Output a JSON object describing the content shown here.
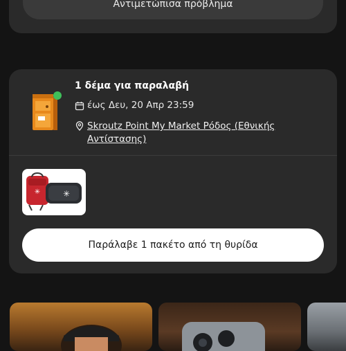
{
  "top_card": {
    "report_button_label": "Αντιμετώπισα πρόβλημα"
  },
  "pickup": {
    "title": "1 δέμα για παραλαβή",
    "deadline": "έως Δευ, 20 Απρ 23:59",
    "location": "Skroutz Point My Market Ρόδος (Εθνικής Αντίστασης)",
    "status_color": "#3fbf5a",
    "locker_icon": "parcel-locker-icon",
    "product_image": "backpack-and-case-image",
    "collect_button_label": "Παράλαβε 1 πακέτο από τη θυρίδα"
  },
  "promos": [
    {
      "image": "person-with-cap-photo"
    },
    {
      "image": "phone-camera-photo"
    },
    {
      "image": "partial-photo"
    }
  ]
}
